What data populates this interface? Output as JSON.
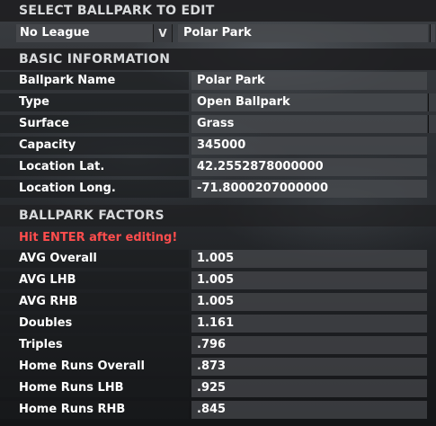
{
  "select_section": {
    "title": "SELECT BALLPARK TO EDIT",
    "league_value": "No League",
    "league_chevron": "V",
    "park_value": "Polar Park"
  },
  "basic_section": {
    "title": "BASIC INFORMATION",
    "fields": [
      {
        "label": "Ballpark Name",
        "value": "Polar Park"
      },
      {
        "label": "Type",
        "value": "Open Ballpark"
      },
      {
        "label": "Surface",
        "value": "Grass"
      },
      {
        "label": "Capacity",
        "value": "345000"
      },
      {
        "label": "Location Lat.",
        "value": "42.2552878000000"
      },
      {
        "label": "Location Long.",
        "value": "-71.8000207000000"
      }
    ]
  },
  "factors_section": {
    "title": "BALLPARK FACTORS",
    "warning": "Hit ENTER after editing!",
    "fields": [
      {
        "label": "AVG Overall",
        "value": "1.005"
      },
      {
        "label": "AVG LHB",
        "value": "1.005"
      },
      {
        "label": "AVG RHB",
        "value": "1.005"
      },
      {
        "label": "Doubles",
        "value": "1.161"
      },
      {
        "label": "Triples",
        "value": ".796"
      },
      {
        "label": "Home Runs Overall",
        "value": ".873"
      },
      {
        "label": "Home Runs LHB",
        "value": ".925"
      },
      {
        "label": "Home Runs RHB",
        "value": ".845"
      }
    ]
  },
  "colors": {
    "warning": "#ff4d4d",
    "section_header_bg": "#1e1e20",
    "field_bg": "#484a4e"
  }
}
